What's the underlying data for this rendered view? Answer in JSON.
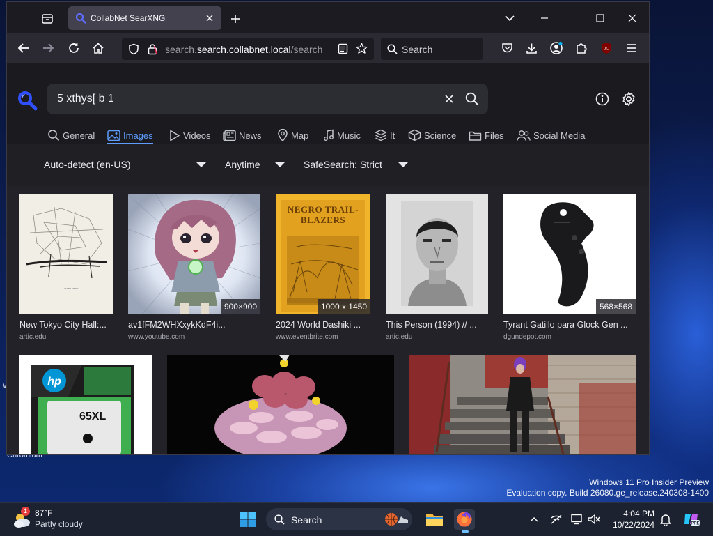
{
  "desktop": {
    "left_label": "W",
    "bottom_label": "Chromium",
    "watermark_line1": "Windows 11 Pro Insider Preview",
    "watermark_line2": "Evaluation copy. Build 26080.ge_release.240308-1400"
  },
  "browser": {
    "tab_title": "CollabNet SearXNG",
    "url_domain": "search.collabnet.local",
    "url_path": "/search",
    "search_placeholder": "Search"
  },
  "page": {
    "query": "5 xthys[ b 1",
    "categories": [
      {
        "label": "General",
        "icon": "search-icon",
        "active": false
      },
      {
        "label": "Images",
        "icon": "image-icon",
        "active": true
      },
      {
        "label": "Videos",
        "icon": "play-icon",
        "active": false
      },
      {
        "label": "News",
        "icon": "newspaper-icon",
        "active": false
      },
      {
        "label": "Map",
        "icon": "map-pin-icon",
        "active": false
      },
      {
        "label": "Music",
        "icon": "music-icon",
        "active": false
      },
      {
        "label": "It",
        "icon": "layers-icon",
        "active": false
      },
      {
        "label": "Science",
        "icon": "cube-icon",
        "active": false
      },
      {
        "label": "Files",
        "icon": "folder-icon",
        "active": false
      },
      {
        "label": "Social Media",
        "icon": "users-icon",
        "active": false
      }
    ],
    "filters": {
      "language": "Auto-detect (en-US)",
      "time": "Anytime",
      "safesearch": "SafeSearch: Strict"
    },
    "results": [
      {
        "title": "New Tokyo City Hall:...",
        "source": "artic.edu",
        "resolution": ""
      },
      {
        "title": "av1fFM2WHXxykKdF4i...",
        "source": "www.youtube.com",
        "resolution": "900×900"
      },
      {
        "title": "2024 World Dashiki ...",
        "source": "www.eventbrite.com",
        "resolution": "1000 x 1450"
      },
      {
        "title": "This Person (1994) // ...",
        "source": "artic.edu",
        "resolution": ""
      },
      {
        "title": "Tyrant Gatillo para Glock Gen ...",
        "source": "dgundepot.com",
        "resolution": "568×568"
      }
    ],
    "book_cover_text": "NEGRO TRAIL-BLAZERS",
    "hp_box_text": "65XL"
  },
  "taskbar": {
    "weather_badge": "1",
    "temperature": "87°F",
    "condition": "Partly cloudy",
    "search_placeholder": "Search",
    "time": "4:04 PM",
    "date": "10/22/2024"
  }
}
